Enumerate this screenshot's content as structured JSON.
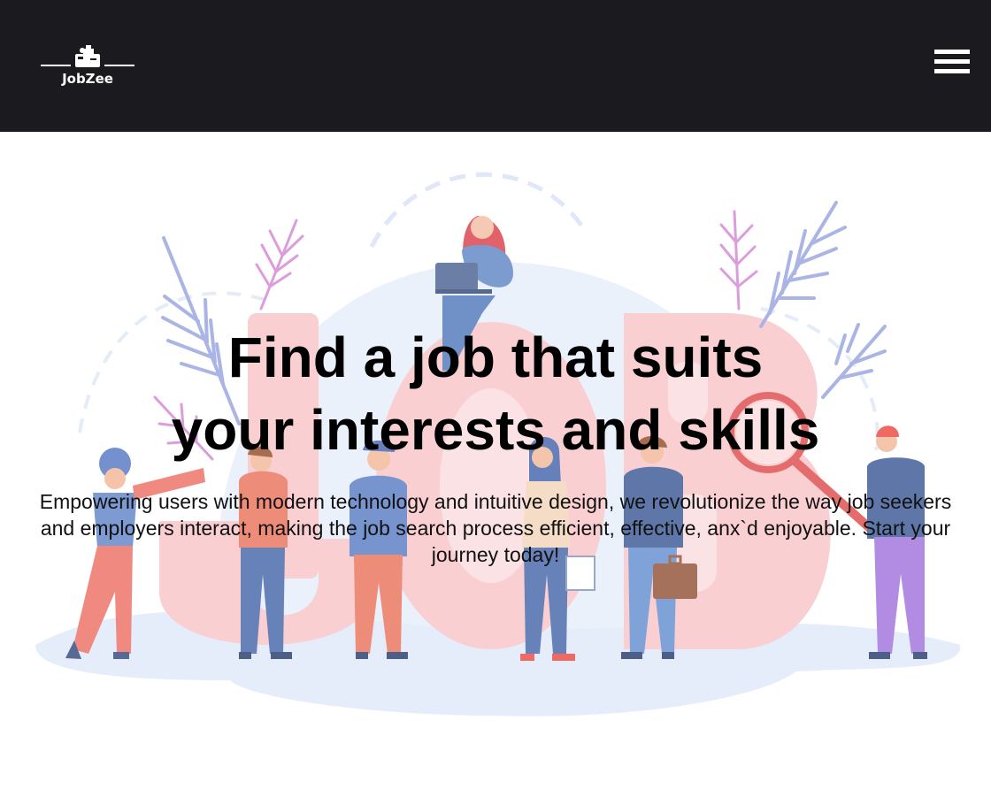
{
  "header": {
    "brand": "JobZee",
    "logo_icon": "briefcase-building-logo",
    "menu_icon": "hamburger-menu-icon",
    "background_color": "#1b1b1f"
  },
  "hero": {
    "title_line1": "Find a job that suits",
    "title_line2": "your interests and skills",
    "subtitle": "Empowering users with modern technology and intuitive design, we revolutionize the way job seekers and employers interact, making the job search process efficient, effective, anx`d enjoyable. Start your journey today!",
    "illustration": "job-seekers-illustration"
  }
}
